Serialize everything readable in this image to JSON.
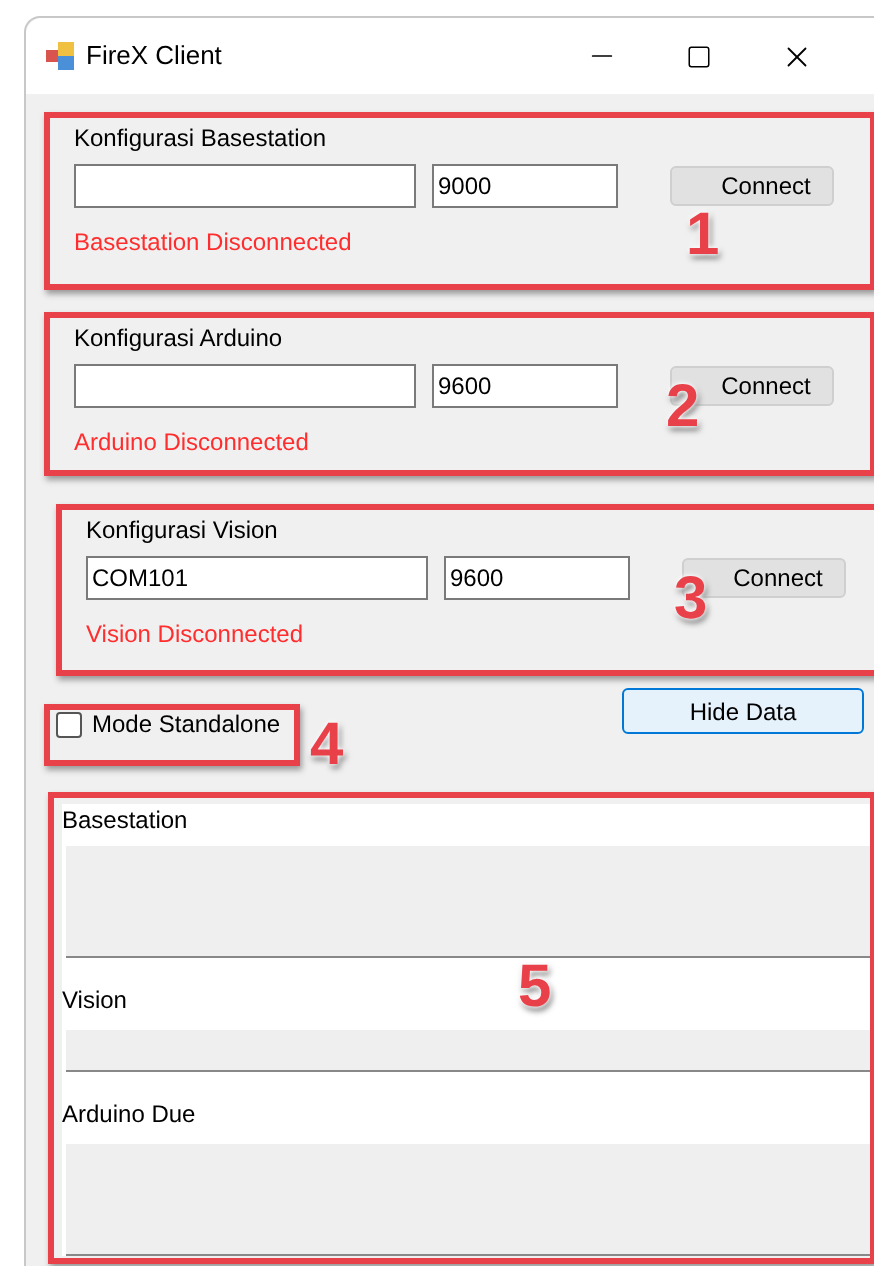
{
  "window": {
    "title": "FireX Client"
  },
  "groups": [
    {
      "title": "Konfigurasi Basestation",
      "port": "9000",
      "button": "Connect",
      "status": "Basestation Disconnected",
      "connected": false,
      "marker": "1"
    },
    {
      "title": "Konfigurasi Arduino",
      "port": "9600",
      "button": "Connect",
      "status": "Arduino Disconnected",
      "connected": false,
      "marker": "2"
    },
    {
      "title": "Konfigurasi Vision",
      "address": "COM101",
      "port": "9600",
      "button": "Connect",
      "status": "Vision Disconnected",
      "connected": false,
      "marker": "3"
    }
  ],
  "standalone": {
    "label": "Mode Standalone",
    "checked": false,
    "marker": "4"
  },
  "hide_button": "Hide Data",
  "data_panel": {
    "marker": "5",
    "sections": [
      {
        "label": "Basestation",
        "kind": "tall"
      },
      {
        "label": "Vision",
        "kind": "short"
      },
      {
        "label": "Arduino Due",
        "kind": "tall"
      }
    ]
  }
}
